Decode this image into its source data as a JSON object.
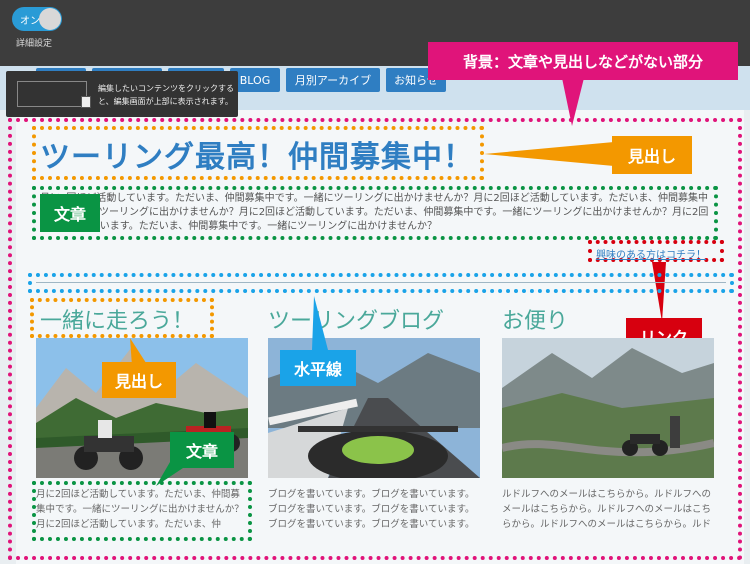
{
  "editor": {
    "toggle_label": "オン",
    "settings_label": "詳細設定"
  },
  "hint": {
    "text": "編集したいコンテンツをクリックすると、編集画面が上部に表示されます。"
  },
  "nav": {
    "items": [
      {
        "label": "BLOG"
      },
      {
        "label": "月別アーカイブ"
      },
      {
        "label": "お知らせ"
      }
    ]
  },
  "callouts": {
    "background": "背景：文章や見出しなどがない部分",
    "heading_1": "見出し",
    "text_1": "文章",
    "link": "リンク",
    "hr": "水平線",
    "heading_2": "見出し",
    "text_2": "文章"
  },
  "main": {
    "heading": "ツーリング最高！仲間募集中！",
    "body": "月に2回ほど活動しています。ただいま、仲間募集中です。一緒にツーリングに出かけませんか？月に2回ほど活動しています。ただいま、仲間募集中です。一緒にツーリングに出かけませんか？月に2回ほど活動しています。ただいま、仲間募集中です。一緒にツーリングに出かけませんか？月に2回ほど活動しています。ただいま、仲間募集中です。一緒にツーリングに出かけませんか？",
    "link_text": "興味のある方はコチラ！"
  },
  "columns": [
    {
      "heading": "一緒に走ろう！",
      "text": "月に2回ほど活動しています。ただいま、仲間募集中です。一緒にツーリングに出かけませんか？月に2回ほど活動しています。ただいま、仲"
    },
    {
      "heading": "ツーリングブログ",
      "text": "ブログを書いています。ブログを書いています。ブログを書いています。ブログを書いています。ブログを書いています。ブログを書いています。"
    },
    {
      "heading": "お便り",
      "text": "ルドルフへのメールはこちらから。ルドルフへのメールはこちらから。ルドルフへのメールはこちらから。ルドルフへのメールはこちらから。ルドル"
    }
  ],
  "colors": {
    "accent_blue": "#2f7ec2",
    "pink": "#e0147a",
    "orange": "#f39800",
    "green": "#0a9444",
    "red": "#d7000f",
    "cyan": "#1aa3e8"
  }
}
